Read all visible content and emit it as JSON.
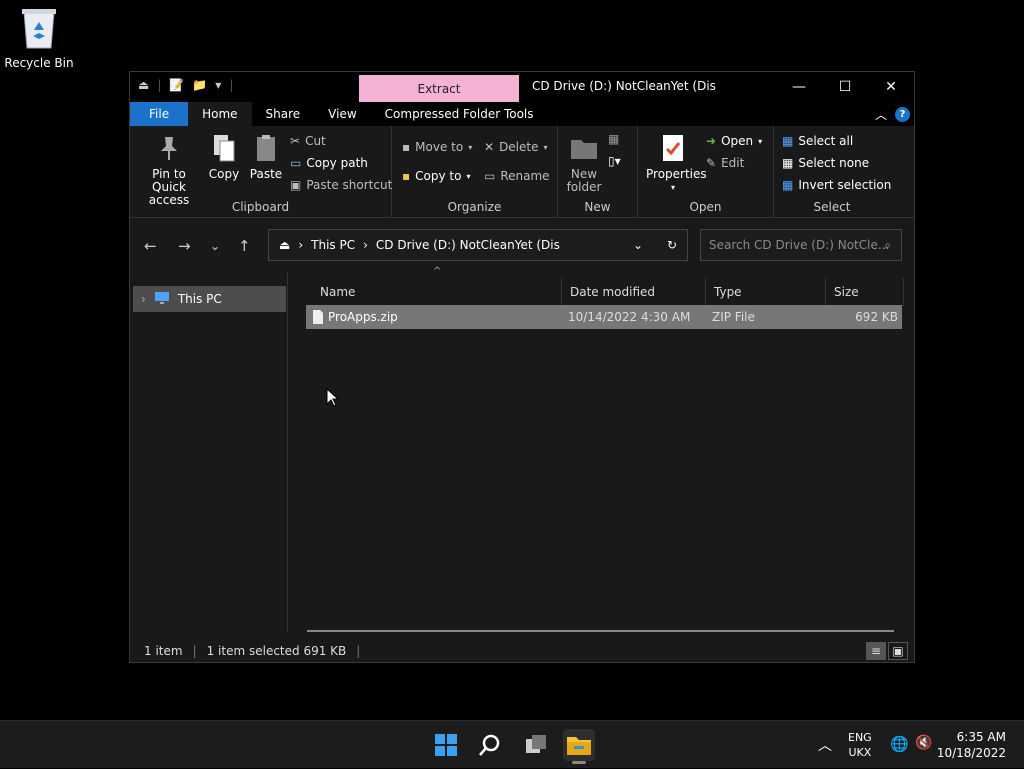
{
  "desktop": {
    "recycle_bin_label": "Recycle Bin"
  },
  "window": {
    "contextual_tab": "Extract",
    "title": "CD Drive (D:) NotCleanYet (Dis",
    "tabs": {
      "file": "File",
      "home": "Home",
      "share": "Share",
      "view": "View",
      "compressed": "Compressed Folder Tools"
    }
  },
  "ribbon": {
    "clipboard": {
      "label": "Clipboard",
      "pin_line1": "Pin to Quick",
      "pin_line2": "access",
      "copy": "Copy",
      "paste": "Paste",
      "cut": "Cut",
      "copy_path": "Copy path",
      "paste_shortcut": "Paste shortcut"
    },
    "organize": {
      "label": "Organize",
      "move_to": "Move to",
      "copy_to": "Copy to",
      "delete": "Delete",
      "rename": "Rename"
    },
    "new": {
      "label": "New",
      "new_folder_line1": "New",
      "new_folder_line2": "folder"
    },
    "open": {
      "label": "Open",
      "properties": "Properties",
      "open": "Open",
      "edit": "Edit"
    },
    "select": {
      "label": "Select",
      "select_all": "Select all",
      "select_none": "Select none",
      "invert": "Invert selection"
    }
  },
  "address": {
    "root": "This PC",
    "current": "CD Drive (D:) NotCleanYet (Dis"
  },
  "search": {
    "placeholder": "Search CD Drive (D:) NotCle..."
  },
  "nav_pane": {
    "this_pc": "This PC"
  },
  "columns": {
    "name": "Name",
    "date": "Date modified",
    "type": "Type",
    "size": "Size"
  },
  "files": [
    {
      "name": "ProApps.zip",
      "date": "10/14/2022 4:30 AM",
      "type": "ZIP File",
      "size": "692 KB"
    }
  ],
  "status": {
    "count": "1 item",
    "selected": "1 item selected  691 KB"
  },
  "taskbar": {
    "lang1": "ENG",
    "lang2": "UKX",
    "time": "6:35 AM",
    "date": "10/18/2022"
  },
  "colors": {
    "file_tab": "#1a73c9",
    "extract_tab": "#f4b2d6",
    "selection": "#777777"
  }
}
